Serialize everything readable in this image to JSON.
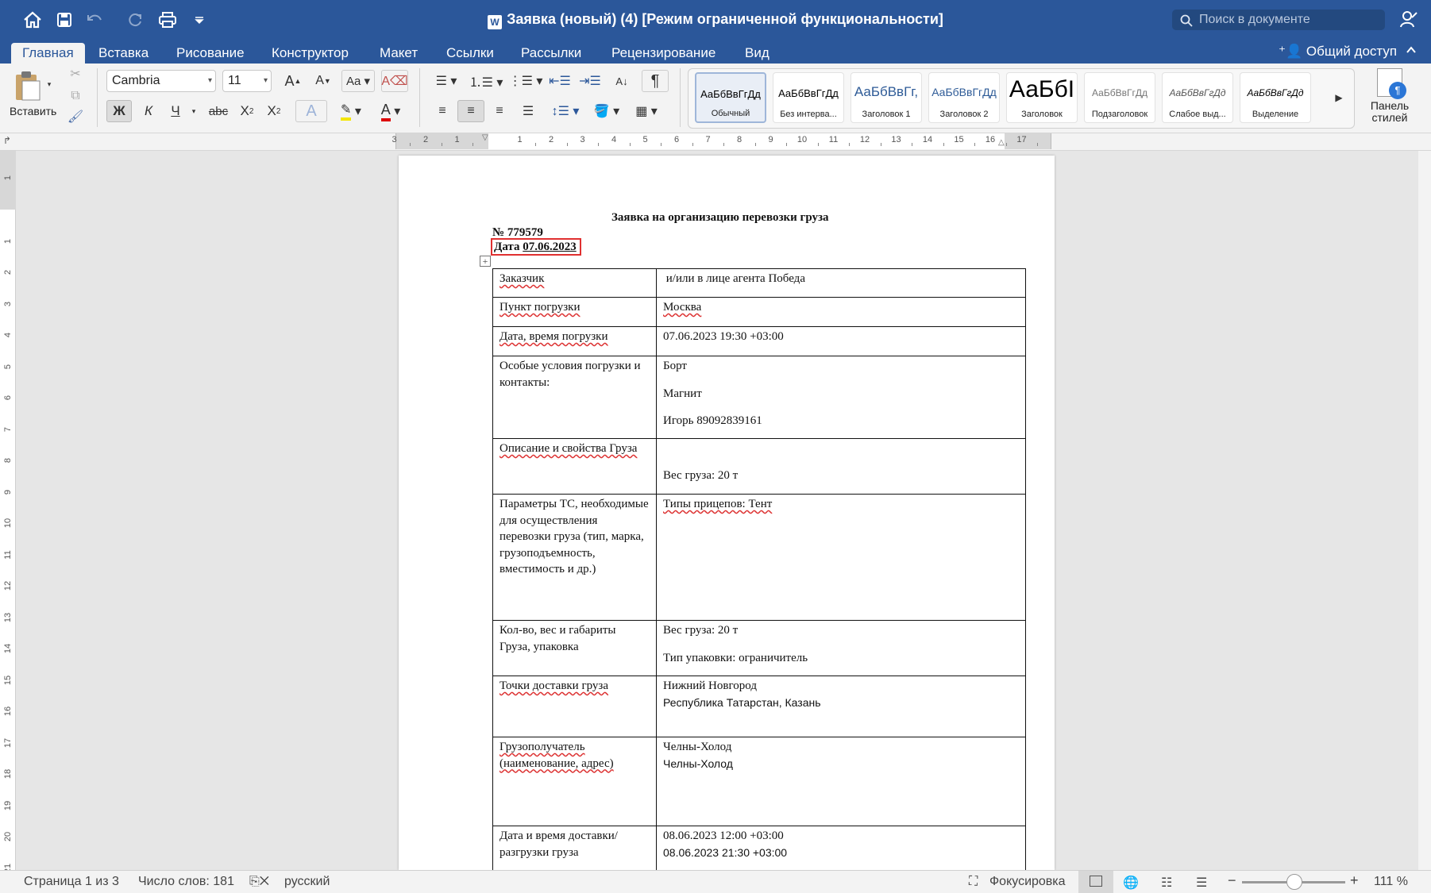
{
  "window": {
    "title": "Заявка (новый) (4) [Режим ограниченной функциональности]",
    "search_placeholder": "Поиск в документе"
  },
  "tabs": [
    {
      "label": "Главная",
      "active": true
    },
    {
      "label": "Вставка"
    },
    {
      "label": "Рисование"
    },
    {
      "label": "Конструктор"
    },
    {
      "label": "Макет"
    },
    {
      "label": "Ссылки"
    },
    {
      "label": "Рассылки"
    },
    {
      "label": "Рецензирование"
    },
    {
      "label": "Вид"
    }
  ],
  "share_label": "Общий доступ",
  "ribbon": {
    "paste_label": "Вставить",
    "font_name": "Cambria",
    "font_size": "11",
    "bold": "Ж",
    "italic": "К",
    "underline": "Ч",
    "strike": "abc",
    "styles_panel_label": "Панель стилей",
    "styles": [
      {
        "sample": "АаБбВвГгДд",
        "name": "Обычный",
        "selected": true
      },
      {
        "sample": "АаБбВвГгДд",
        "name": "Без интерва..."
      },
      {
        "sample": "АаБбВвГг,",
        "name": "Заголовок 1"
      },
      {
        "sample": "АаБбВвГгДд",
        "name": "Заголовок 2"
      },
      {
        "sample": "АаБбІ",
        "name": "Заголовок"
      },
      {
        "sample": "АаБбВвГгДд",
        "name": "Подзаголовок"
      },
      {
        "sample": "АаБбВвГгДд",
        "name": "Слабое выд..."
      },
      {
        "sample": "АаБбВвГгДд",
        "name": "Выделение"
      }
    ]
  },
  "ruler_numbers": [
    "3",
    "2",
    "1",
    "1",
    "2",
    "3",
    "4",
    "5",
    "6",
    "7",
    "8",
    "9",
    "10",
    "11",
    "12",
    "13",
    "14",
    "15",
    "16",
    "17"
  ],
  "vruler_numbers": [
    "1",
    "1",
    "2",
    "3",
    "4",
    "5",
    "6",
    "7",
    "8",
    "9",
    "10",
    "11",
    "12",
    "13",
    "14",
    "15",
    "16",
    "17",
    "18",
    "19",
    "20",
    "21"
  ],
  "document": {
    "title": "Заявка на организацию перевозки груза",
    "number": "№ 779579",
    "date_label": "Дата",
    "date_value": "07.06.2023",
    "rows": [
      {
        "label": "Заказчик",
        "value_lines": [
          " и/или в лице агента Победа"
        ]
      },
      {
        "label": "Пункт погрузки",
        "value_lines": [
          "Москва"
        ]
      },
      {
        "label": "Дата, время погрузки",
        "value_lines": [
          "07.06.2023 19:30 +03:00"
        ]
      },
      {
        "label": "Особые условия погрузки и контакты:",
        "value_lines": [
          "Борт",
          "",
          "Магнит",
          "",
          "Игорь 89092839161"
        ]
      },
      {
        "label": "Описание и свойства Груза",
        "value_lines": [
          "",
          "",
          "Вес груза: 20 т"
        ]
      },
      {
        "label": "Параметры ТС, необходимые для осуществления перевозки груза (тип, марка, грузоподъемность, вместимость и др.)",
        "value_lines": [
          "Типы прицепов: Тент"
        ]
      },
      {
        "label": "Кол-во, вес и габариты Груза, упаковка",
        "value_lines": [
          "Вес груза: 20 т",
          "",
          "Тип упаковки: ограничитель"
        ]
      },
      {
        "label": "Точки доставки груза",
        "value_lines": [
          "Нижний Новгород",
          "Республика Татарстан, Казань"
        ]
      },
      {
        "label": "Грузополучатель (наименование, адрес)",
        "value_lines": [
          "Челны-Холод",
          "Челны-Холод"
        ]
      },
      {
        "label": "Дата и время доставки/разгрузки груза",
        "value_lines": [
          "08.06.2023 12:00 +03:00",
          "08.06.2023 21:30 +03:00"
        ]
      }
    ]
  },
  "status": {
    "page": "Страница 1 из 3",
    "words": "Число слов: 181",
    "language": "русский",
    "focus": "Фокусировка",
    "zoom": "111 %"
  },
  "colors": {
    "accent": "#2b579a",
    "highlight_box": "#e03030"
  }
}
